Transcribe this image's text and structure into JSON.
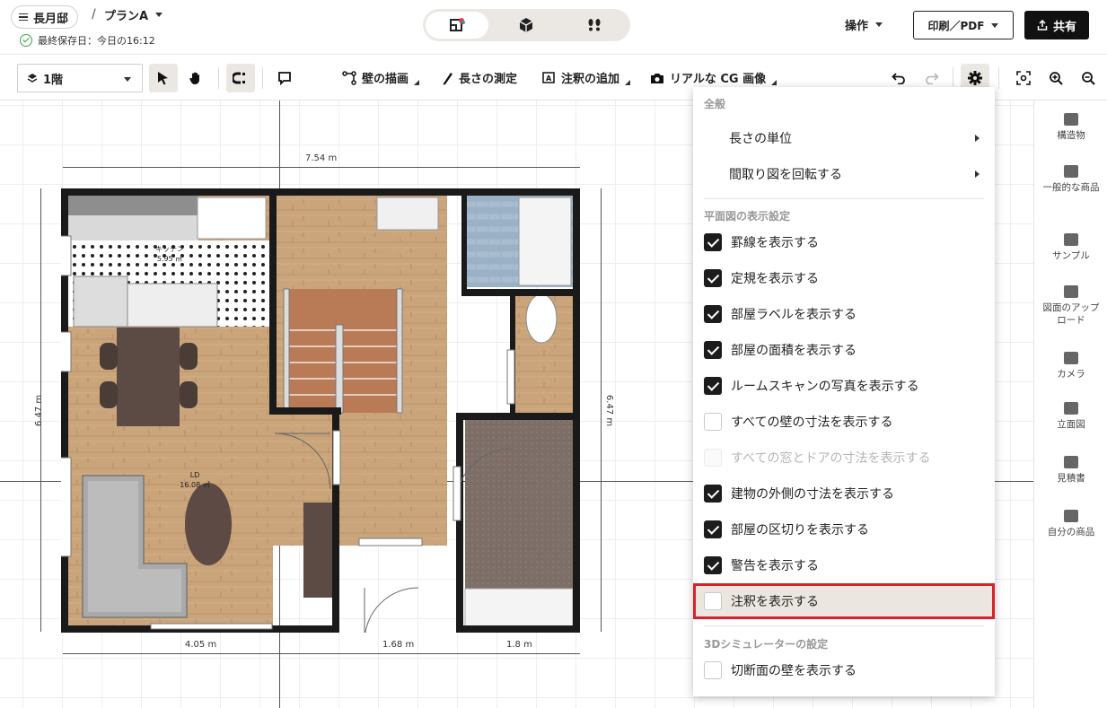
{
  "header": {
    "project_name": "長月邸",
    "separator": "/",
    "plan_name": "プランA",
    "saved_status": "最終保存日：今日の16:12",
    "operations_label": "操作",
    "print_label": "印刷／PDF",
    "share_label": "共有"
  },
  "view_switch": {
    "icons": [
      "floorplan-2d-icon",
      "box-3d-icon",
      "walkthrough-icon"
    ],
    "active": "floorplan-2d"
  },
  "toolbar": {
    "floor_select": "1階",
    "tools": {
      "draw_wall": "壁の描画",
      "measure": "長さの測定",
      "annotate": "注釈の追加",
      "cg_image": "リアルな CG 画像"
    }
  },
  "floorplan": {
    "dim_top": "7.54 m",
    "dim_left": "6.47 m",
    "dim_right": "6.47 m",
    "dim_bottom_1": "4.05 m",
    "dim_bottom_2": "1.68 m",
    "dim_bottom_3": "1.8 m",
    "rooms": {
      "kitchen_name": "キッチン",
      "kitchen_area": "5.95 ㎡",
      "ld_name": "LD",
      "ld_area": "16.08 ㎡"
    }
  },
  "right_sidebar": {
    "items": [
      {
        "label": "構造物",
        "icon": "structure-icon"
      },
      {
        "label": "一般的な商品",
        "icon": "furniture-icon"
      },
      {
        "label": "サンプル",
        "icon": "sample-icon"
      },
      {
        "label": "図面のアップロード",
        "icon": "upload-icon"
      },
      {
        "label": "カメラ",
        "icon": "camera-icon"
      },
      {
        "label": "立面図",
        "icon": "elevation-icon"
      },
      {
        "label": "見積書",
        "icon": "estimate-icon"
      },
      {
        "label": "自分の商品",
        "icon": "my-products-icon"
      }
    ]
  },
  "settings_menu": {
    "general_title": "全般",
    "length_unit": "長さの単位",
    "rotate_plan": "間取り図を回転する",
    "display_title": "平面図の表示設定",
    "options": [
      {
        "label": "罫線を表示する",
        "checked": true
      },
      {
        "label": "定規を表示する",
        "checked": true
      },
      {
        "label": "部屋ラベルを表示する",
        "checked": true
      },
      {
        "label": "部屋の面積を表示する",
        "checked": true
      },
      {
        "label": "ルームスキャンの写真を表示する",
        "checked": true
      },
      {
        "label": "すべての壁の寸法を表示する",
        "checked": false
      },
      {
        "label": "すべての窓とドアの寸法を表示する",
        "checked": false,
        "disabled": true
      },
      {
        "label": "建物の外側の寸法を表示する",
        "checked": true
      },
      {
        "label": "部屋の区切りを表示する",
        "checked": true
      },
      {
        "label": "警告を表示する",
        "checked": true
      },
      {
        "label": "注釈を表示する",
        "checked": false,
        "highlighted": true
      }
    ],
    "sim_title": "3Dシミュレーターの設定",
    "sim_option": {
      "label": "切断面の壁を表示する",
      "checked": false
    }
  },
  "colors": {
    "wood_floor": "#c7a27a",
    "wall": "#1a1a1a",
    "highlight_border": "#d7222b",
    "accent_dark": "#111111"
  }
}
